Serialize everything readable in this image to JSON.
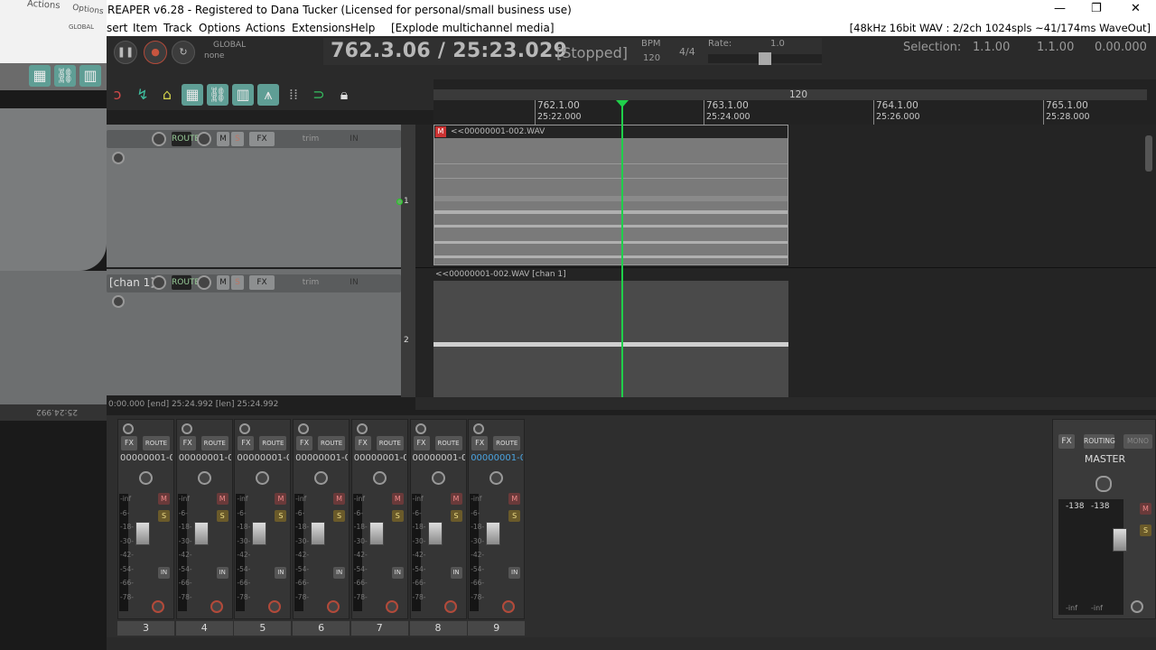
{
  "window": {
    "title": "REAPER v6.28 - Registered to Dana Tucker (Licensed for personal/small business use)",
    "minimize": "—",
    "maximize": "❐",
    "close": "✕"
  },
  "menu": {
    "items": [
      "sert",
      "Item",
      "Track",
      "Options",
      "Actions",
      "Extensions",
      "Help",
      "[Explode multichannel media]"
    ],
    "status": "[48kHz 16bit WAV : 2/2ch 1024spls ~41/174ms WaveOut]"
  },
  "transport": {
    "global_label": "GLOBAL",
    "global_value": "none",
    "position": "762.3.06 / 25:23.029",
    "state": "[Stopped]",
    "bpm_label": "BPM",
    "bpm": "120",
    "time_sig": "4/4",
    "rate_label": "Rate:",
    "rate": "1.0",
    "selection_label": "Selection:",
    "sel_start": "1.1.00",
    "sel_end": "1.1.00",
    "sel_len": "0.00.000"
  },
  "ruler": {
    "tempo_marker": "120",
    "marks": [
      {
        "bar": "762.1.00",
        "time": "25:22.000"
      },
      {
        "bar": "763.1.00",
        "time": "25:24.000"
      },
      {
        "bar": "764.1.00",
        "time": "25:26.000"
      },
      {
        "bar": "765.1.00",
        "time": "25:28.000"
      }
    ]
  },
  "tracks": [
    {
      "name": "",
      "number": "1",
      "item": "<<00000001-002.WAV"
    },
    {
      "name": "[chan 1]",
      "number": "2",
      "item": "<<00000001-002.WAV [chan 1]"
    }
  ],
  "tcp_buttons": {
    "route": "ROUTE",
    "mute": "M",
    "solo": "S",
    "fx": "FX",
    "trim": "trim",
    "in": "IN"
  },
  "status_row": "0:00.000 [end] 25:24.992 [len] 25:24.992",
  "mixer": {
    "strips": [
      {
        "name": "00000001-0",
        "number": "3"
      },
      {
        "name": "00000001-0",
        "number": "4"
      },
      {
        "name": "00000001-0",
        "number": "5"
      },
      {
        "name": "00000001-0",
        "number": "6"
      },
      {
        "name": "00000001-0",
        "number": "7"
      },
      {
        "name": "00000001-0",
        "number": "8"
      },
      {
        "name": "00000001-0",
        "number": "9"
      }
    ],
    "scale": [
      "-inf",
      "-6-",
      "-18-",
      "-30-",
      "-42-",
      "-54-",
      "-66-",
      "-78-"
    ],
    "fx": "FX",
    "route": "ROUTE",
    "mute": "M",
    "solo": "S",
    "in": "IN",
    "master": {
      "name": "MASTER",
      "routing": "ROUTING",
      "mono": "MONO",
      "peak_l": "-138",
      "peak_r": "-138",
      "bottom_l": "-inf",
      "bottom_r": "-inf"
    }
  },
  "left_window": {
    "title_text": "Actions",
    "menu_text": "Options",
    "global": "GLOBAL",
    "status": "25:24.992"
  }
}
